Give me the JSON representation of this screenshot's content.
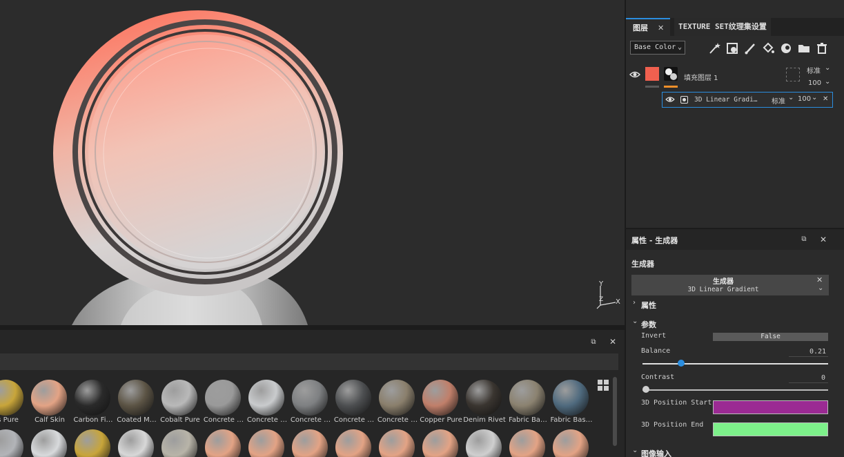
{
  "layers_panel": {
    "tabs": [
      {
        "label": "图层"
      },
      {
        "label": "TEXTURE SET纹理集设置"
      }
    ],
    "channel_select": "Base Color",
    "layer": {
      "name": "填充图层 1",
      "blend_mode": "标准",
      "opacity": "100",
      "thumb_color": "#f0604f"
    },
    "sublayer": {
      "name": "3D Linear Gradi…",
      "blend_mode": "标准",
      "opacity": "100"
    }
  },
  "properties_panel": {
    "title": "属性 - 生成器",
    "section_generator": "生成器",
    "generator_box": {
      "title": "生成器",
      "value": "3D Linear Gradient"
    },
    "group_attributes": "属性",
    "group_params": "参数",
    "params": {
      "invert_label": "Invert",
      "invert_value": "False",
      "balance_label": "Balance",
      "balance_value": "0.21",
      "balance_fraction": 0.21,
      "contrast_label": "Contrast",
      "contrast_value": "0",
      "contrast_fraction": 0,
      "pos_start_label": "3D Position Start",
      "pos_start_color": "#9b2a93",
      "pos_end_label": "3D Position End",
      "pos_end_color": "#7df08a"
    },
    "group_image_input": "图像输入"
  },
  "shelf": {
    "materials_row1": [
      {
        "label": "ss Pure",
        "color": "#c8a53a"
      },
      {
        "label": "Calf Skin",
        "color": "#e3a385"
      },
      {
        "label": "Carbon Fi…",
        "color": "#2a2a2a"
      },
      {
        "label": "Coated M…",
        "color": "#5c5445"
      },
      {
        "label": "Cobalt Pure",
        "color": "#b9b9b9"
      },
      {
        "label": "Concrete …",
        "color": "#9a9a9a"
      },
      {
        "label": "Concrete …",
        "color": "#c9cbcd"
      },
      {
        "label": "Concrete …",
        "color": "#7e8082"
      },
      {
        "label": "Concrete …",
        "color": "#4d4f51"
      },
      {
        "label": "Concrete …",
        "color": "#8a7f6c"
      },
      {
        "label": "Copper Pure",
        "color": "#c07f6a"
      },
      {
        "label": "Denim Rivet",
        "color": "#3a3530"
      },
      {
        "label": "Fabric Ba…",
        "color": "#8b8270"
      },
      {
        "label": "Fabric Bas…",
        "color": "#4f6a7e"
      }
    ],
    "materials_row2": [
      {
        "label": "",
        "color": "#b2b4b8"
      },
      {
        "label": "",
        "color": "#d8dadc"
      },
      {
        "label": "",
        "color": "#c8a53a"
      },
      {
        "label": "",
        "color": "#d8d8d8"
      },
      {
        "label": "",
        "color": "#b8b4a8"
      },
      {
        "label": "",
        "color": "#e3a385"
      },
      {
        "label": "",
        "color": "#e3a385"
      },
      {
        "label": "",
        "color": "#e3a385"
      },
      {
        "label": "",
        "color": "#e3a385"
      },
      {
        "label": "",
        "color": "#e3a385"
      },
      {
        "label": "",
        "color": "#e3a385"
      },
      {
        "label": "",
        "color": "#cfcfcf"
      },
      {
        "label": "",
        "color": "#e3a385"
      },
      {
        "label": "",
        "color": "#e3a385"
      }
    ]
  },
  "viewport": {
    "axis_y": "Y",
    "axis_x": "X",
    "axis_z": "Z"
  },
  "colors": {
    "accent": "#2b8ee0",
    "slider_knob": "#2b8ee0",
    "layer_mask_bar": "#f0902a"
  }
}
